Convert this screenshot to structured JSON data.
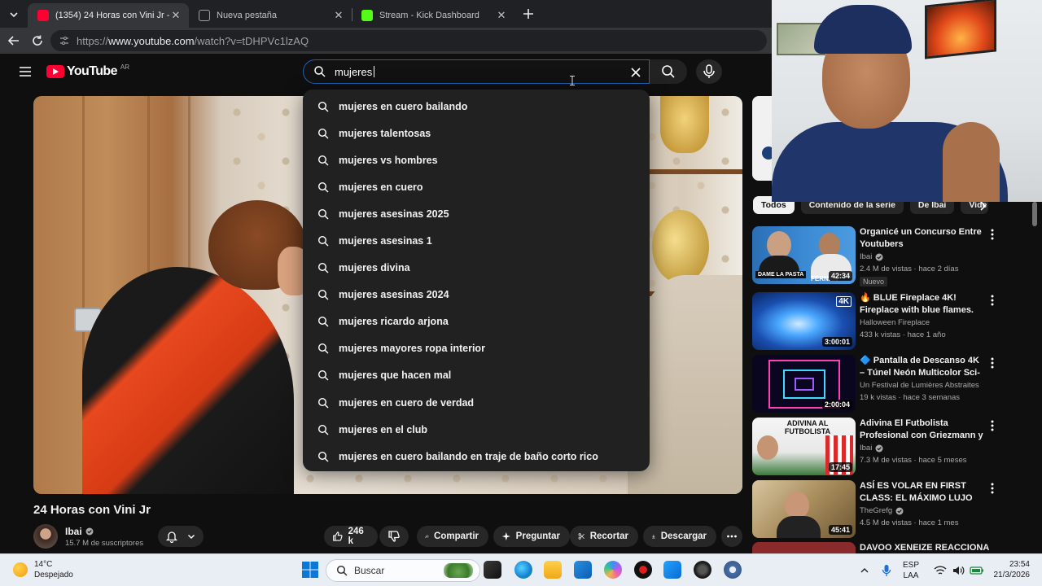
{
  "browser": {
    "tabs": [
      {
        "title": "(1354) 24 Horas con Vini Jr - YouTube",
        "favicon": "youtube-favicon",
        "active": true
      },
      {
        "title": "Nueva pestaña",
        "favicon": "new-tab-favicon",
        "active": false
      },
      {
        "title": "Stream - Kick Dashboard",
        "favicon": "kick-favicon",
        "active": false
      }
    ],
    "url_prefix": "https://",
    "url_host": "www.youtube.com",
    "url_path": "/watch?v=tDHPVc1lzAQ"
  },
  "youtube": {
    "logo_text": "YouTube",
    "country_code": "AR",
    "search": {
      "query": "mujeres",
      "suggestions": [
        "mujeres en cuero bailando",
        "mujeres talentosas",
        "mujeres vs hombres",
        "mujeres en cuero",
        "mujeres asesinas 2025",
        "mujeres asesinas 1",
        "mujeres divina",
        "mujeres asesinas 2024",
        "mujeres ricardo arjona",
        "mujeres mayores ropa interior",
        "mujeres que hacen mal",
        "mujeres en cuero de verdad",
        "mujeres en el club",
        "mujeres en cuero bailando en traje de baño corto rico"
      ]
    },
    "video": {
      "title": "24 Horas con Vini Jr",
      "channel": "Ibai",
      "subscribers": "15.7 M de suscriptores",
      "likes": "246 k",
      "share_label": "Compartir",
      "ask_label": "Preguntar",
      "clip_label": "Recortar",
      "download_label": "Descargar"
    },
    "chips": [
      "Todos",
      "Contenido de la serie",
      "De Ibai",
      "Vide"
    ],
    "recommendations": [
      {
        "title": "Organicé un Concurso Entre Youtubers",
        "channel": "Ibai",
        "verified": true,
        "meta": "2.4 M de vistas · hace 2 días",
        "badge": "Nuevo",
        "duration": "42:34"
      },
      {
        "title": "🔥 BLUE Fireplace 4K! Fireplace with blue flames. Halloween ...",
        "channel": "Halloween Fireplace",
        "verified": false,
        "meta": "433 k vistas · hace 1 año",
        "badge": "",
        "duration": "3:00:01"
      },
      {
        "title": "🔷 Pantalla de Descanso 4K – Túnel Neón Multicolor Sci-Fi – ...",
        "channel": "Un Festival de Lumières Abstraites",
        "verified": false,
        "meta": "19 k vistas · hace 3 semanas",
        "badge": "",
        "duration": "2:00:04"
      },
      {
        "title": "Adivina El Futbolista Profesional con Griezmann y ...",
        "channel": "Ibai",
        "verified": true,
        "meta": "7.3 M de vistas · hace 5 meses",
        "badge": "",
        "duration": "17:45"
      },
      {
        "title": "ASÍ ES VOLAR EN FIRST CLASS: EL MÁXIMO LUJO",
        "channel": "TheGrefg",
        "verified": true,
        "meta": "4.5 M de vistas · hace 1 mes",
        "badge": "",
        "duration": "45:41"
      },
      {
        "title": "DAVOO XENEIZE REACCIONA",
        "channel": "",
        "verified": false,
        "meta": "",
        "badge": "",
        "duration": ""
      }
    ],
    "thumb_texts": {
      "rec1_left": "DAME LA PASTA",
      "rec1_right": "FERNAN",
      "rec2": "4K",
      "rec4": "ADIVINA AL FUTBOLISTA"
    }
  },
  "taskbar": {
    "weather_temp": "14°C",
    "weather_desc": "Despejado",
    "search_placeholder": "Buscar",
    "lang_top": "ESP",
    "lang_bottom": "LAA",
    "time": "23:54",
    "date": "21/3/2026"
  }
}
